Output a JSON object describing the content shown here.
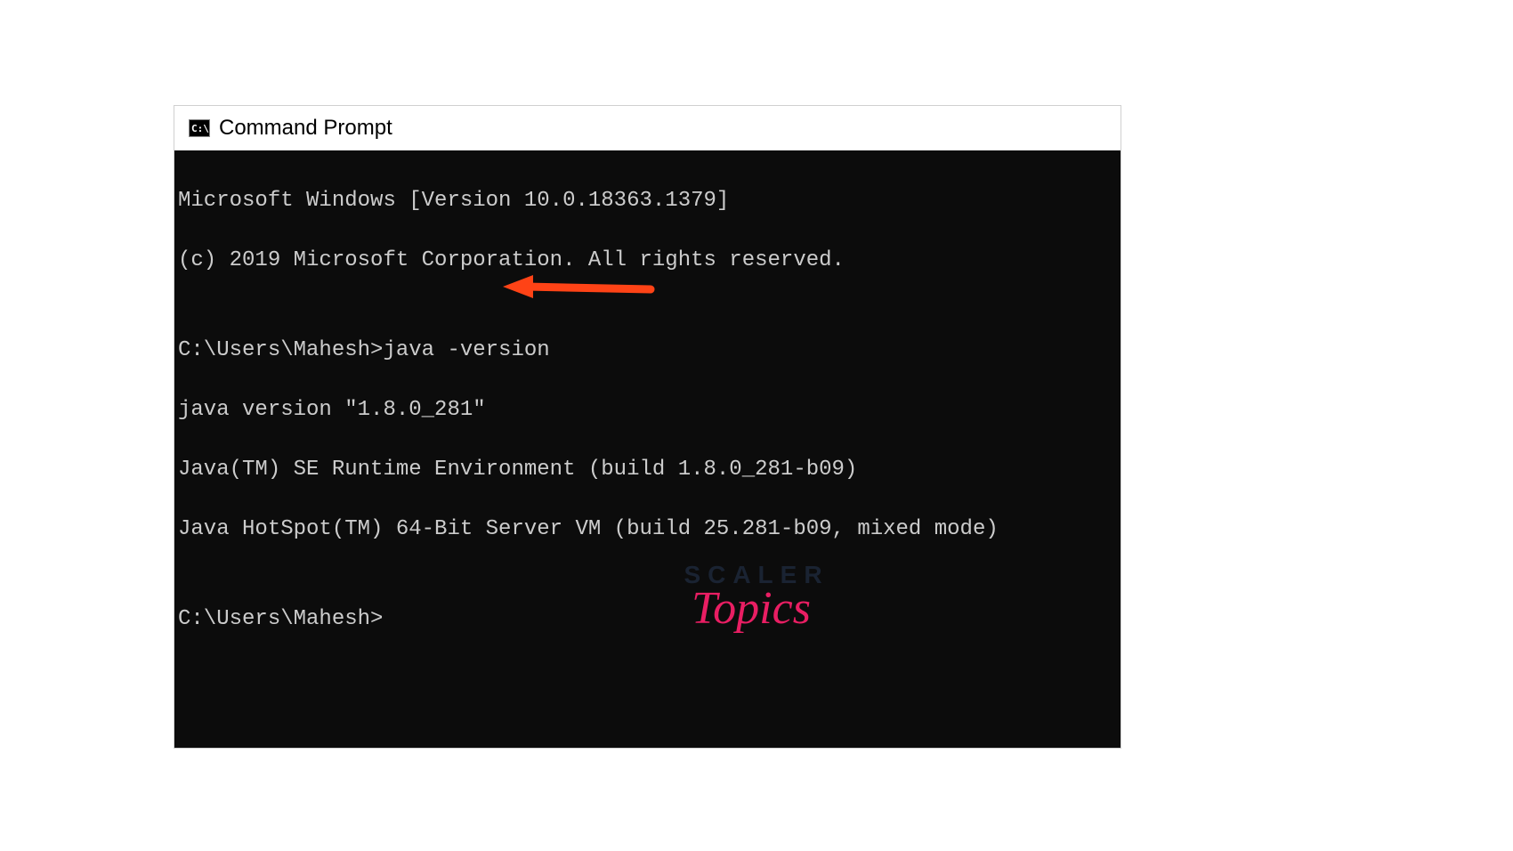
{
  "window": {
    "icon_label": "C:\\",
    "title": "Command Prompt"
  },
  "terminal": {
    "line1": "Microsoft Windows [Version 10.0.18363.1379]",
    "line2": "(c) 2019 Microsoft Corporation. All rights reserved.",
    "blank1": "",
    "prompt1": "C:\\Users\\Mahesh>java -version",
    "output1": "java version \"1.8.0_281\"",
    "output2": "Java(TM) SE Runtime Environment (build 1.8.0_281-b09)",
    "output3": "Java HotSpot(TM) 64-Bit Server VM (build 25.281-b09, mixed mode)",
    "blank2": "",
    "prompt2": "C:\\Users\\Mahesh>"
  },
  "annotation": {
    "arrow_color": "#ff4316"
  },
  "brand": {
    "line1": "SCALER",
    "line2": "Topics"
  }
}
